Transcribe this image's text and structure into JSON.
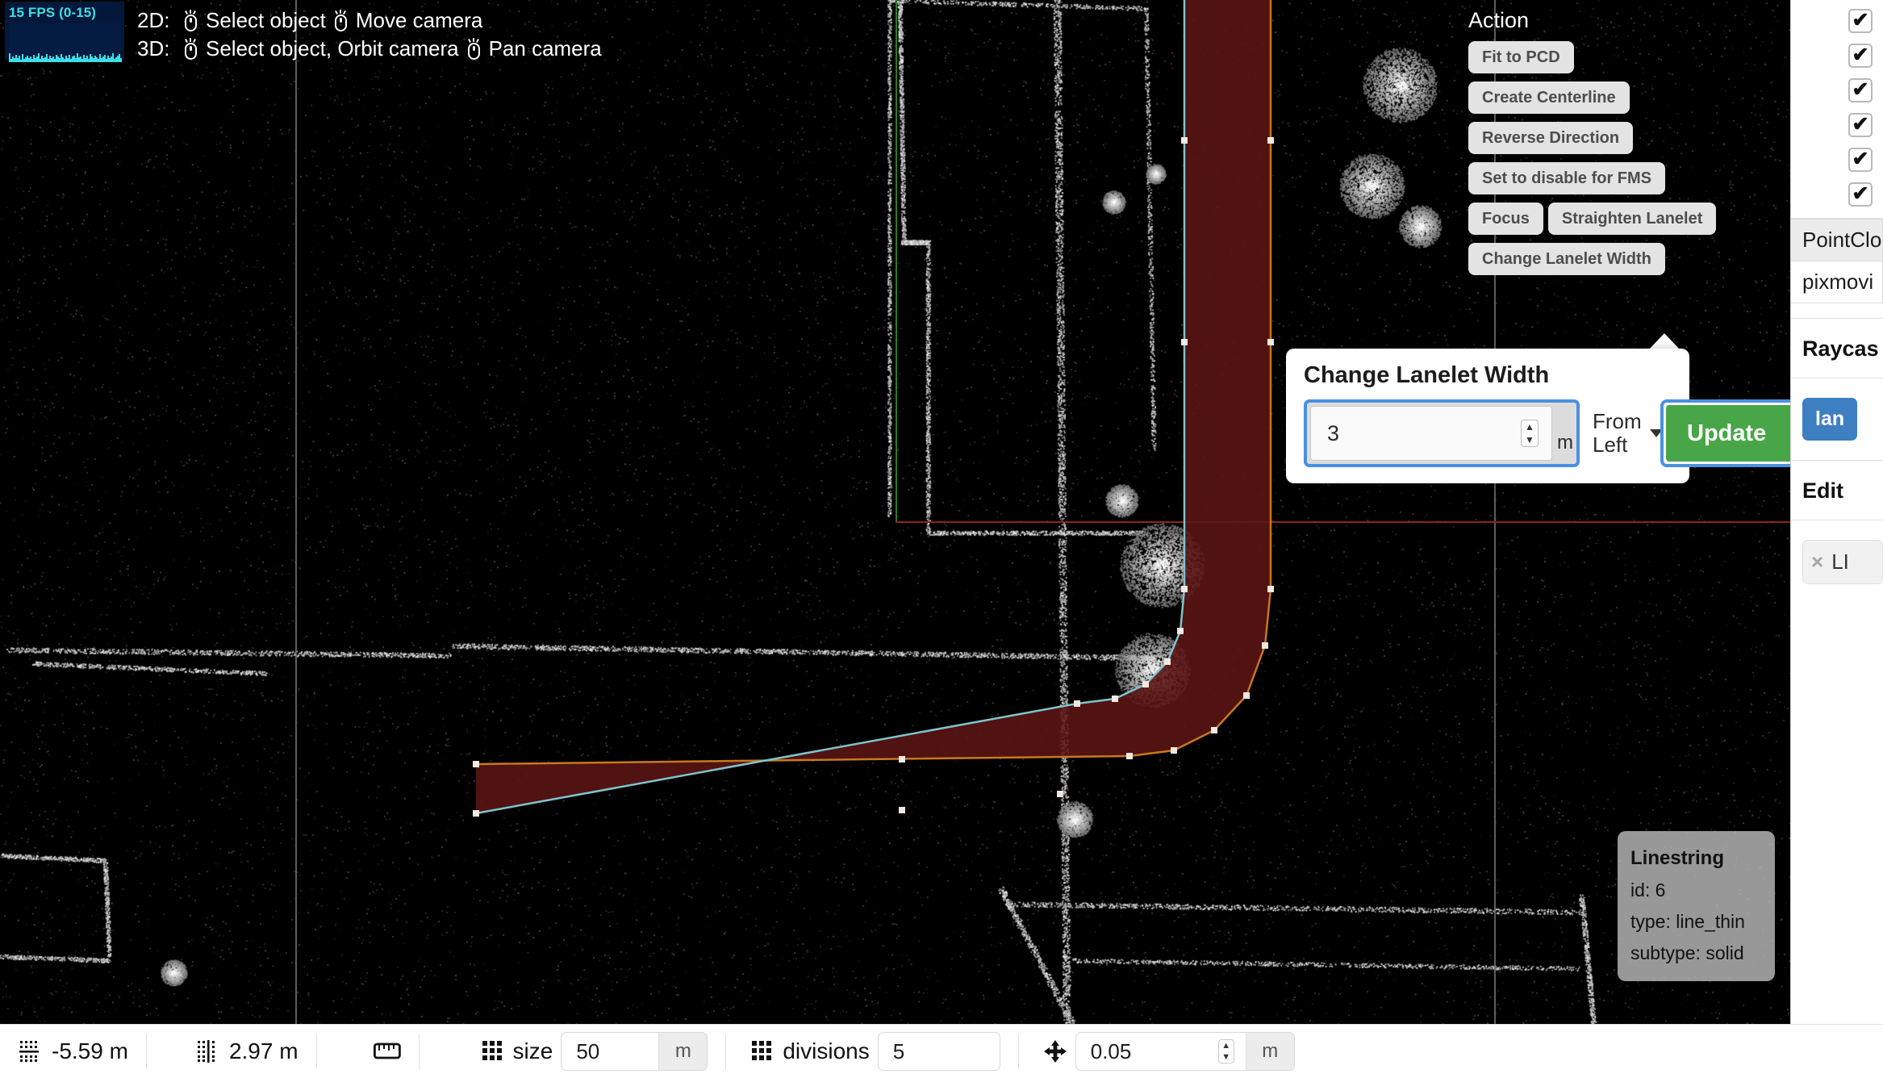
{
  "fps": {
    "label": "15 FPS (0-15)",
    "bars": [
      38,
      12,
      22,
      16,
      30,
      18,
      26,
      10,
      34,
      14,
      20,
      28,
      16,
      24,
      12,
      30,
      18,
      22,
      36,
      14,
      26,
      16,
      20,
      32,
      12,
      28,
      18,
      24,
      14,
      30,
      22,
      16,
      34,
      20,
      12,
      26,
      18,
      30,
      14,
      22,
      28,
      16,
      36,
      20,
      24,
      12,
      30,
      18,
      26,
      14,
      34,
      22,
      16,
      28,
      20,
      12,
      32,
      18,
      24,
      30,
      14,
      26,
      16,
      22,
      38,
      12,
      20,
      28,
      34,
      18
    ]
  },
  "hints": {
    "rows": [
      {
        "prefix": "2D:",
        "first_icon": "mouse-icon",
        "first_label": "Select object",
        "second_icon": "mouse-icon",
        "second_label": "Move camera"
      },
      {
        "prefix": "3D:",
        "first_icon": "mouse-icon",
        "first_label": "Select object, Orbit camera",
        "second_icon": "mouse-icon",
        "second_label": "Pan camera"
      }
    ]
  },
  "action_panel": {
    "title": "Action",
    "rows": [
      [
        "Fit to PCD"
      ],
      [
        "Create Centerline"
      ],
      [
        "Reverse Direction"
      ],
      [
        "Set to disable for FMS"
      ],
      [
        "Focus",
        "Straighten Lanelet"
      ],
      [
        "Change Lanelet Width"
      ]
    ]
  },
  "popover": {
    "title": "Change Lanelet Width",
    "width_value": "3",
    "width_unit": "m",
    "side_select": "From Left",
    "update_label": "Update",
    "check_icon": "check-icon"
  },
  "linestring_tooltip": {
    "title": "Linestring",
    "id": "id: 6",
    "type": "type: line_thin",
    "subtype": "subtype: solid"
  },
  "sidebar": {
    "checkbox_count": 6,
    "checkbox_glyph": "✔",
    "table_header": "PointClo",
    "table_value": "pixmovi",
    "section_raycast": "Raycas",
    "blue_button": "lan",
    "section_edit": "Edit",
    "tag_close": "×",
    "tag_label": "LI"
  },
  "statusbar": {
    "offset_x": "-5.59 m",
    "offset_y": "2.97 m",
    "grid_size_label": "size",
    "grid_size_value": "50",
    "grid_size_unit": "m",
    "divisions_label": "divisions",
    "divisions_value": "5",
    "step_value": "0.05",
    "step_unit": "m",
    "icons": {
      "offset_x": "horizontal-offset-icon",
      "offset_y": "vertical-offset-icon",
      "ruler": "ruler-icon",
      "grid_size": "grid-icon",
      "divisions": "grid-icon",
      "step": "move-arrows-icon"
    }
  },
  "colors": {
    "lanelet_fill": "#5c1414",
    "lanelet_left_border": "#c8781e",
    "lanelet_right_border": "#5fb6bf",
    "accent_blue": "#4a90e2",
    "update_green": "#48a648",
    "fps_cyan": "#3ae0e8"
  }
}
